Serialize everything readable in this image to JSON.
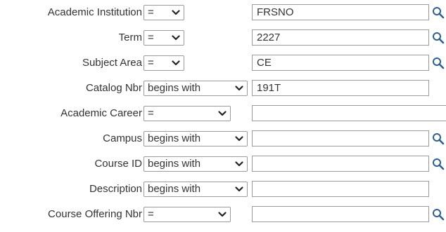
{
  "fields": [
    {
      "label": "Academic Institution",
      "operator": "=",
      "value": "FRSNO",
      "lookup": true
    },
    {
      "label": "Term",
      "operator": "=",
      "value": "2227",
      "lookup": true
    },
    {
      "label": "Subject Area",
      "operator": "=",
      "value": "CE",
      "lookup": true
    },
    {
      "label": "Catalog Nbr",
      "operator": "begins with",
      "value": "191T",
      "lookup": false
    },
    {
      "label": "Academic Career",
      "operator": "=",
      "value": "",
      "lookup": false
    },
    {
      "label": "Campus",
      "operator": "begins with",
      "value": "",
      "lookup": true
    },
    {
      "label": "Course ID",
      "operator": "begins with",
      "value": "",
      "lookup": true
    },
    {
      "label": "Description",
      "operator": "begins with",
      "value": "",
      "lookup": false
    },
    {
      "label": "Course Offering Nbr",
      "operator": "=",
      "value": "",
      "lookup": true
    }
  ],
  "icons": {
    "dropdown": "chevron-down-icon",
    "lookup": "magnifier-icon"
  },
  "colors": {
    "text": "#333333",
    "border": "#9b9b9b",
    "lookup_icon": "#2f5f8f"
  }
}
